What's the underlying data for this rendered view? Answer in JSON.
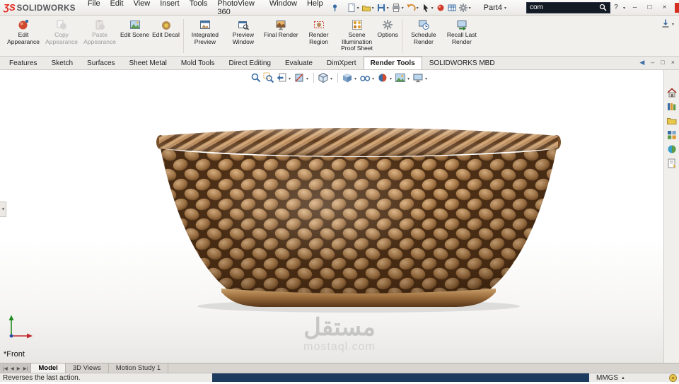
{
  "glyphs": {
    "caret": "▾",
    "up_caret": "▲",
    "minimize": "–",
    "restore": "□",
    "close": "×",
    "help": "?",
    "back": "◀",
    "left_tiny": "◄"
  },
  "colors": {
    "accent_red": "#e2231a",
    "accent_blue": "#3a6ea5",
    "basket_mid": "#a97a49",
    "basket_dark": "#4e3016",
    "basket_light": "#dbb384",
    "status_fill": "#1d3a5f"
  },
  "titlebar": {
    "brand_prefix": "ƷS",
    "brand": "SOLIDWORKS",
    "menus": [
      "File",
      "Edit",
      "View",
      "Insert",
      "Tools",
      "PhotoView 360",
      "Window",
      "Help"
    ],
    "doc_title": "Part4",
    "search_value": "com"
  },
  "ribbon": {
    "buttons": [
      {
        "label": "Edit Appearance",
        "enabled": true
      },
      {
        "label": "Copy Appearance",
        "enabled": false
      },
      {
        "label": "Paste Appearance",
        "enabled": false
      },
      {
        "label": "Edit Scene",
        "enabled": true
      },
      {
        "label": "Edit Decal",
        "enabled": true
      },
      {
        "label": "Integrated Preview",
        "enabled": true
      },
      {
        "label": "Preview Window",
        "enabled": true
      },
      {
        "label": "Final Render",
        "enabled": true
      },
      {
        "label": "Render Region",
        "enabled": true
      },
      {
        "label": "Scene Illumination Proof Sheet",
        "enabled": true
      },
      {
        "label": "Options",
        "enabled": true
      },
      {
        "label": "Schedule Render",
        "enabled": true
      },
      {
        "label": "Recall Last Render",
        "enabled": true
      }
    ]
  },
  "tabs": {
    "items": [
      "Features",
      "Sketch",
      "Surfaces",
      "Sheet Metal",
      "Mold Tools",
      "Direct Editing",
      "Evaluate",
      "DimXpert",
      "Render Tools",
      "SOLIDWORKS MBD"
    ],
    "active": "Render Tools"
  },
  "viewport": {
    "view_label": "*Front",
    "watermark_title": "مستقل",
    "watermark_site": "mostaql.com"
  },
  "bottom": {
    "nav": [
      "|◀",
      "◀",
      "▶",
      "▶|"
    ],
    "tabs": [
      "Model",
      "3D Views",
      "Motion Study 1"
    ],
    "active": "Model"
  },
  "statusbar": {
    "message": "Reverses the last action.",
    "units": "MMGS"
  }
}
